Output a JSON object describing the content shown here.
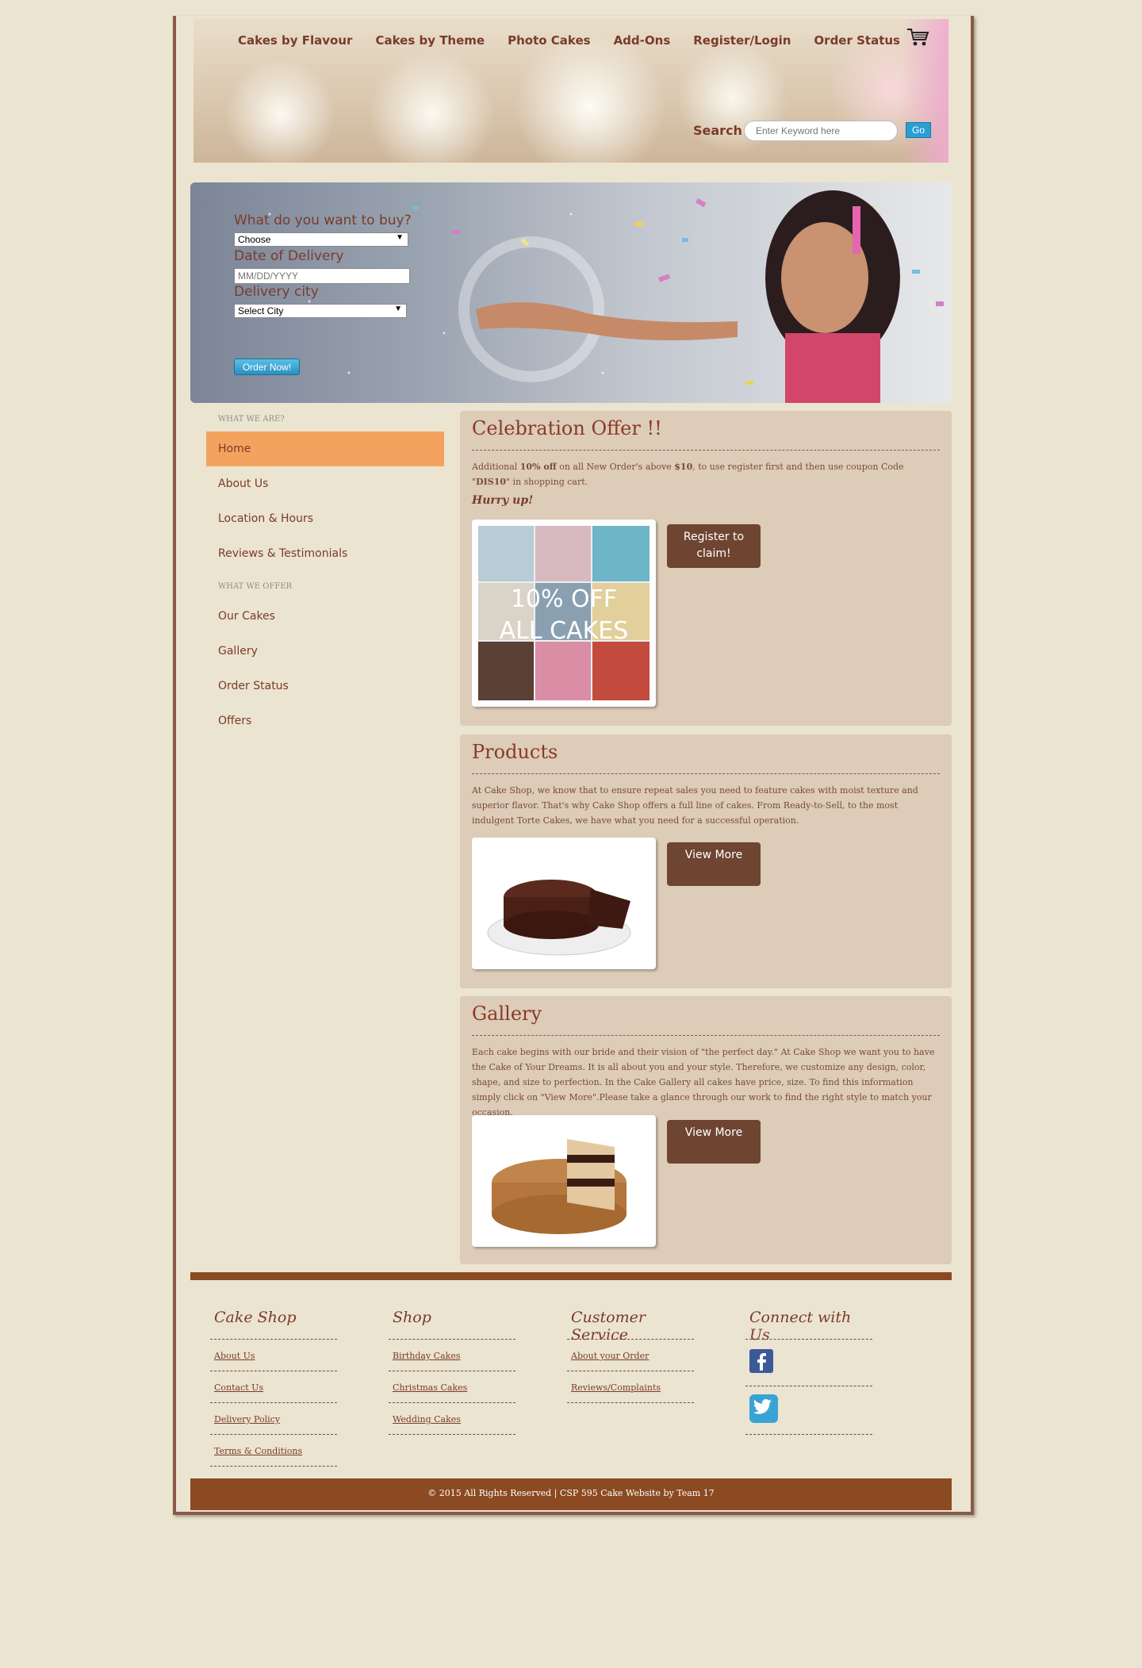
{
  "header": {
    "nav": [
      "Cakes by Flavour",
      "Cakes by Theme",
      "Photo Cakes",
      "Add-Ons",
      "Register/Login",
      "Order Status"
    ],
    "search_label": "Search",
    "search_placeholder": "Enter Keyword here",
    "go_label": "Go"
  },
  "banner": {
    "q1": "What do you want to buy?",
    "q1_value": "Choose",
    "q2": "Date of Delivery",
    "q2_placeholder": "MM/DD/YYYY",
    "q3": "Delivery city",
    "q3_value": "Select City",
    "order_label": "Order Now!"
  },
  "sidebar": {
    "section1": "WHAT WE ARE?",
    "items1": [
      "Home",
      "About Us",
      "Location & Hours",
      "Reviews & Testimonials"
    ],
    "section2": "WHAT WE OFFER",
    "items2": [
      "Our Cakes",
      "Gallery",
      "Order Status",
      "Offers"
    ]
  },
  "offer": {
    "title": "Celebration Offer !!",
    "text_a": "Additional ",
    "text_b": "10% off",
    "text_c": " on all New Order's above ",
    "text_d": "$10",
    "text_e": ", to use register first and then use coupon Code \"",
    "text_f": "DIS10",
    "text_g": "\" in shopping cart.",
    "hurry": "Hurry up!",
    "image_text_1": "10% OFF",
    "image_text_2": "ALL CAKES",
    "button": "Register to claim!"
  },
  "products": {
    "title": "Products",
    "text": "At Cake Shop, we know that to ensure repeat sales you need to feature cakes with moist texture and superior flavor. That's why Cake Shop offers a full line of cakes. From Ready-to-Sell, to the most indulgent Torte Cakes, we have what you need for a successful operation.",
    "button": "View More"
  },
  "gallery": {
    "title": "Gallery",
    "text": "Each cake begins with our bride and their vision of \"the perfect day.\" At Cake Shop we want you to have the Cake of Your Dreams. It is all about you and your style. Therefore, we customize any design, color, shape, and size to perfection. In the Cake Gallery all cakes have price, size. To find this information simply click on \"View More\".Please take a glance through our work to find the right style to match your occasion.",
    "button": "View More"
  },
  "footer": {
    "col1_title": "Cake Shop",
    "col1_links": [
      "About Us",
      "Contact Us",
      "Delivery Policy",
      "Terms & Conditions"
    ],
    "col2_title": "Shop",
    "col2_links": [
      "Birthday Cakes",
      "Christmas Cakes",
      "Wedding Cakes"
    ],
    "col3_title": "Customer Service",
    "col3_links": [
      "About your Order",
      "Reviews/Complaints"
    ],
    "col4_title": "Connect with Us",
    "copyright": "© 2015 All Rights Reserved   |   CSP 595 Cake Website by Team 17"
  },
  "colors": {
    "page_bg": "#ebe4d0",
    "accent_orange": "#f4a35f",
    "brown_dark": "#8b4a22",
    "button_brown": "#6e4530",
    "content_box": "#dcccb8",
    "go_blue": "#2b9ed3"
  }
}
